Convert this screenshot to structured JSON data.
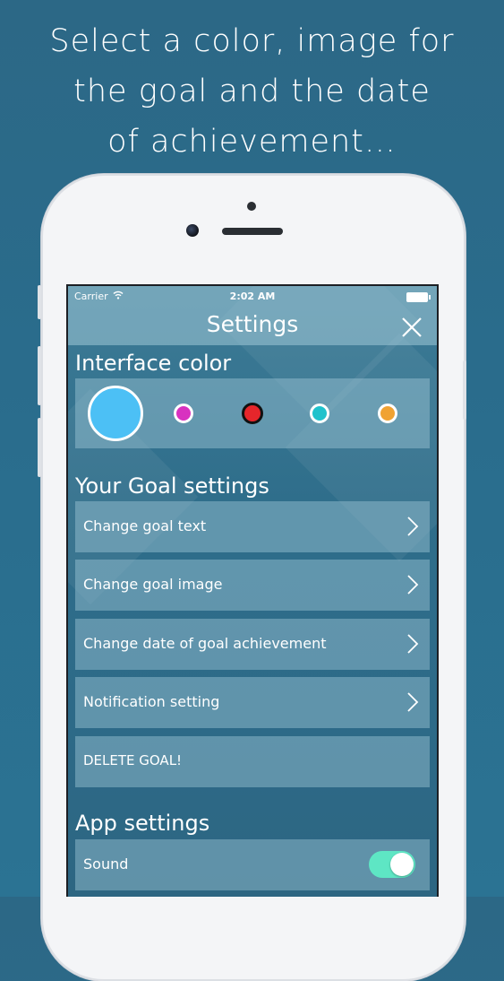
{
  "headline": {
    "line1": "Select a color,  image for",
    "line2": "the goal and the date",
    "line3": "of achievement…"
  },
  "status": {
    "carrier": "Carrier",
    "time": "2:02 AM"
  },
  "nav": {
    "title": "Settings"
  },
  "interface_color": {
    "title": "Interface color",
    "swatches": [
      {
        "name": "light-blue",
        "color": "#4cc0f5",
        "selected": true
      },
      {
        "name": "magenta",
        "color": "#d831c0",
        "selected": false
      },
      {
        "name": "red",
        "color": "#e6262b",
        "selected": false
      },
      {
        "name": "cyan",
        "color": "#1fc2cc",
        "selected": false
      },
      {
        "name": "orange",
        "color": "#f0a232",
        "selected": false
      }
    ]
  },
  "goal_settings": {
    "title": "Your Goal settings",
    "rows": [
      {
        "label": "Change goal text"
      },
      {
        "label": "Change goal image"
      },
      {
        "label": "Change date of goal achievement"
      },
      {
        "label": "Notification setting"
      },
      {
        "label": "DELETE GOAL!"
      }
    ]
  },
  "app_settings": {
    "title": "App settings",
    "sound_label": "Sound",
    "sound_on": true
  },
  "colors": {
    "background": "#2b6b8a",
    "toggle_on": "#5ee6c4"
  }
}
